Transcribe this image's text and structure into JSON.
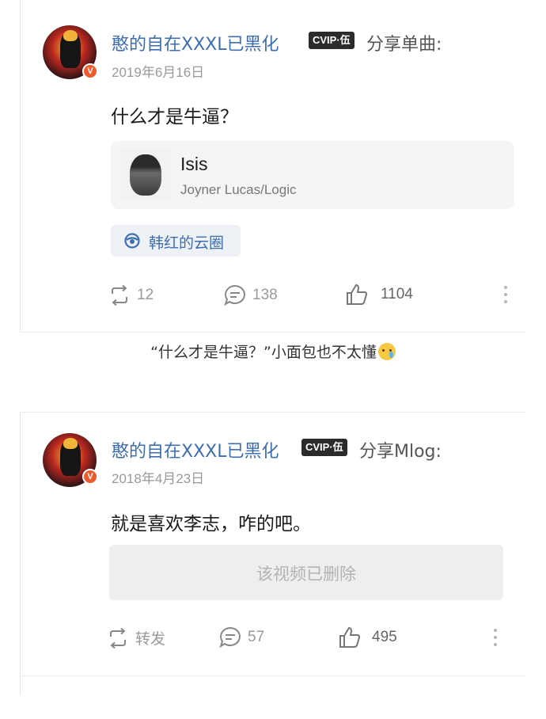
{
  "post1": {
    "author": "憨的自在XXXL已黑化",
    "vip_badge": "CVIP·伍",
    "share_action": "分享单曲:",
    "date": "2019年6月16日",
    "text": "什么才是牛逼？",
    "music": {
      "title": "Isis",
      "artist": "Joyner Lucas/Logic"
    },
    "topic": "韩红的云圈",
    "actions": {
      "repost": "12",
      "comment": "138",
      "like": "1104"
    }
  },
  "caption": "“什么才是牛逼？”小面包也不太懂",
  "post2": {
    "author": "憨的自在XXXL已黑化",
    "vip_badge": "CVIP·伍",
    "share_action": "分享Mlog:",
    "date": "2018年4月23日",
    "text": "就是喜欢李志，咋的吧。",
    "deleted_notice": "该视频已删除",
    "actions": {
      "repost": "转发",
      "comment": "57",
      "like": "495"
    }
  },
  "icons": {
    "verified": "v-badge-icon",
    "repost": "repost-icon",
    "comment": "comment-icon",
    "like": "thumbs-up-icon",
    "more": "more-vertical-icon",
    "topic": "cloud-circle-icon",
    "emoji": "crying-face-emoji"
  },
  "colors": {
    "link_blue": "#3e6eaf",
    "meta_gray": "#9a9a9a",
    "verified_orange": "#ef5a2c"
  }
}
